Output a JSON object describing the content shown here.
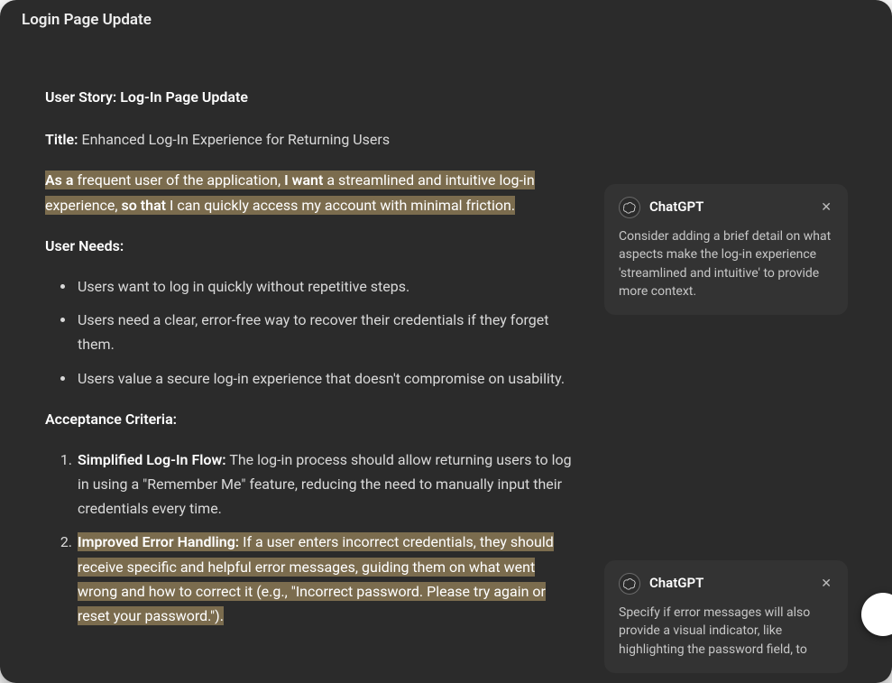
{
  "window": {
    "title": "Login Page Update"
  },
  "doc": {
    "heading": "User Story: Log-In Page Update",
    "title_label": "Title:",
    "title_value": "Enhanced Log-In Experience for Returning Users",
    "story": {
      "as_a": "As a",
      "as_a_rest": " frequent user of the application, ",
      "i_want": "I want",
      "i_want_rest": " a streamlined and intuitive log-in experience, ",
      "so_that": "so that",
      "so_that_rest": " I can quickly access my account with minimal friction."
    },
    "user_needs_heading": "User Needs:",
    "user_needs": [
      "Users want to log in quickly without repetitive steps.",
      "Users need a clear, error-free way to recover their credentials if they forget them.",
      "Users value a secure log-in experience that doesn't compromise on usability."
    ],
    "acceptance_heading": "Acceptance Criteria:",
    "acceptance": [
      {
        "title": "Simplified Log-In Flow:",
        "body": " The log-in process should allow returning users to log in using a \"Remember Me\" feature, reducing the need to manually input their credentials every time."
      },
      {
        "title": "Improved Error Handling:",
        "body": " If a user enters incorrect credentials, they should receive specific and helpful error messages, guiding them on what went wrong and how to correct it (e.g., \"Incorrect password. Please try again or reset your password.\")."
      }
    ]
  },
  "comments": [
    {
      "author": "ChatGPT",
      "body": "Consider adding a brief detail on what aspects make the log-in experience 'streamlined and intuitive' to provide more context."
    },
    {
      "author": "ChatGPT",
      "body": "Specify if error messages will also provide a visual indicator, like highlighting the password field, to"
    }
  ],
  "icons": {
    "close": "✕",
    "openai": "openai-logo"
  }
}
